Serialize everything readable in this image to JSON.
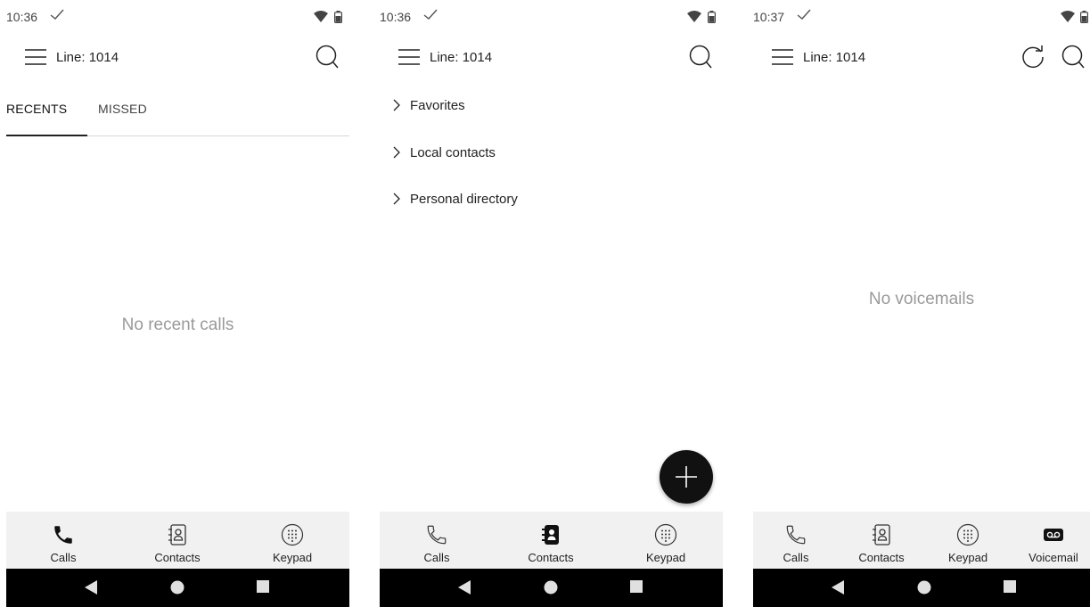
{
  "screens": [
    {
      "status": {
        "time": "10:36"
      },
      "appbar": {
        "line_label": "Line: 1014"
      },
      "tabs": {
        "recents": "RECENTS",
        "missed": "MISSED"
      },
      "empty_text": "No recent calls",
      "nav": {
        "calls": "Calls",
        "contacts": "Contacts",
        "keypad": "Keypad"
      },
      "active_nav": "calls"
    },
    {
      "status": {
        "time": "10:36"
      },
      "appbar": {
        "line_label": "Line: 1014"
      },
      "groups": [
        {
          "label": "Favorites"
        },
        {
          "label": "Local contacts"
        },
        {
          "label": "Personal directory"
        }
      ],
      "nav": {
        "calls": "Calls",
        "contacts": "Contacts",
        "keypad": "Keypad"
      },
      "active_nav": "contacts",
      "fab_icon": "plus-icon"
    },
    {
      "status": {
        "time": "10:37"
      },
      "appbar": {
        "line_label": "Line: 1014"
      },
      "empty_text": "No voicemails",
      "nav": {
        "calls": "Calls",
        "contacts": "Contacts",
        "keypad": "Keypad",
        "voicemail": "Voicemail"
      },
      "active_nav": "voicemail"
    }
  ],
  "icons": {
    "status": [
      "check-icon",
      "wifi-icon",
      "battery-icon"
    ],
    "appbar": [
      "menu-icon",
      "search-icon",
      "refresh-icon"
    ],
    "nav": [
      "phone-icon",
      "contacts-book-icon",
      "keypad-icon",
      "voicemail-icon"
    ],
    "system": [
      "back-icon",
      "home-icon",
      "recents-icon"
    ]
  },
  "colors": {
    "text": "#222222",
    "muted": "#9a9a9a",
    "nav_bg": "#f1f1f2",
    "fab": "#111111",
    "system_bar": "#000000"
  }
}
